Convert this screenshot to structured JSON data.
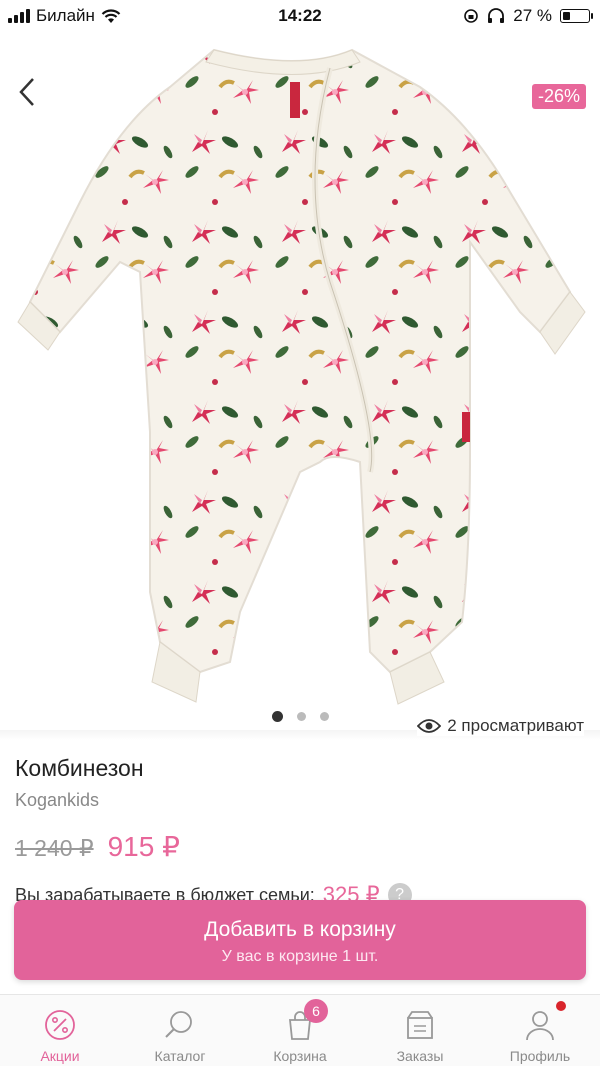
{
  "status_bar": {
    "carrier": "Билайн",
    "time": "14:22",
    "battery": "27 %"
  },
  "product": {
    "discount": "-26%",
    "viewers": "2 просматривают",
    "title": "Комбинезон",
    "brand": "Kogankids",
    "old_price": "1 240 ₽",
    "new_price": "915 ₽",
    "image_count": 3,
    "active_image": 0
  },
  "earn": {
    "text": "Вы зарабатываете в бюджет семьи:",
    "amount": "325 ₽"
  },
  "cart_button": {
    "label": "Добавить в корзину",
    "sub": "У вас в корзине 1 шт."
  },
  "tabbar": {
    "items": [
      {
        "label": "Акции",
        "icon": "percent-icon"
      },
      {
        "label": "Каталог",
        "icon": "search-icon"
      },
      {
        "label": "Корзина",
        "icon": "bag-icon",
        "badge": "6"
      },
      {
        "label": "Заказы",
        "icon": "box-icon"
      },
      {
        "label": "Профиль",
        "icon": "user-icon"
      }
    ]
  },
  "colors": {
    "accent": "#e2639a",
    "badge_dot": "#d9242b"
  }
}
